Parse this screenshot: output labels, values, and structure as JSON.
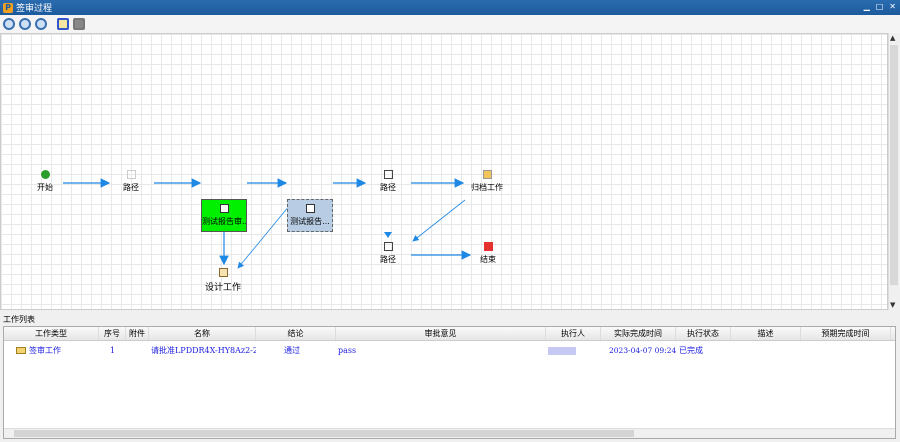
{
  "window": {
    "title": "签审过程",
    "logo": "P"
  },
  "toolbar": {
    "icons": [
      "zoom-fit-icon",
      "zoom-in-icon",
      "zoom-out-icon",
      "center-icon",
      "comment-icon"
    ]
  },
  "flow": {
    "nodes": {
      "start": "开始",
      "route1": "路径",
      "test_review": "测试报告审...",
      "test_report": "测试报告...",
      "route2": "路径",
      "archive": "归档工作",
      "route3": "路径",
      "end": "结束",
      "design": "设计工作"
    }
  },
  "worklist": {
    "title": "工作列表",
    "columns": [
      "工作类型",
      "序号",
      "附件",
      "名称",
      "结论",
      "审批意见",
      "执行人",
      "实际完成时间",
      "执行状态",
      "描述",
      "预期完成时间"
    ],
    "rows": [
      {
        "type": "签审工作",
        "seq": "1",
        "attachment": "",
        "name": "请批准LPDDR4X-HY8Az2-2...",
        "result": "通过",
        "opinion": "pass",
        "executor": "",
        "actual_time": "2023-04-07 09:24",
        "status": "已完成",
        "desc": "",
        "expected_time": ""
      }
    ]
  },
  "colors": {
    "titlebar": "#1c5a9c",
    "active_node": "#00f000",
    "pending_node": "#b8cde4",
    "link_text": "#2020e0",
    "arrow": "#1e88e5"
  }
}
